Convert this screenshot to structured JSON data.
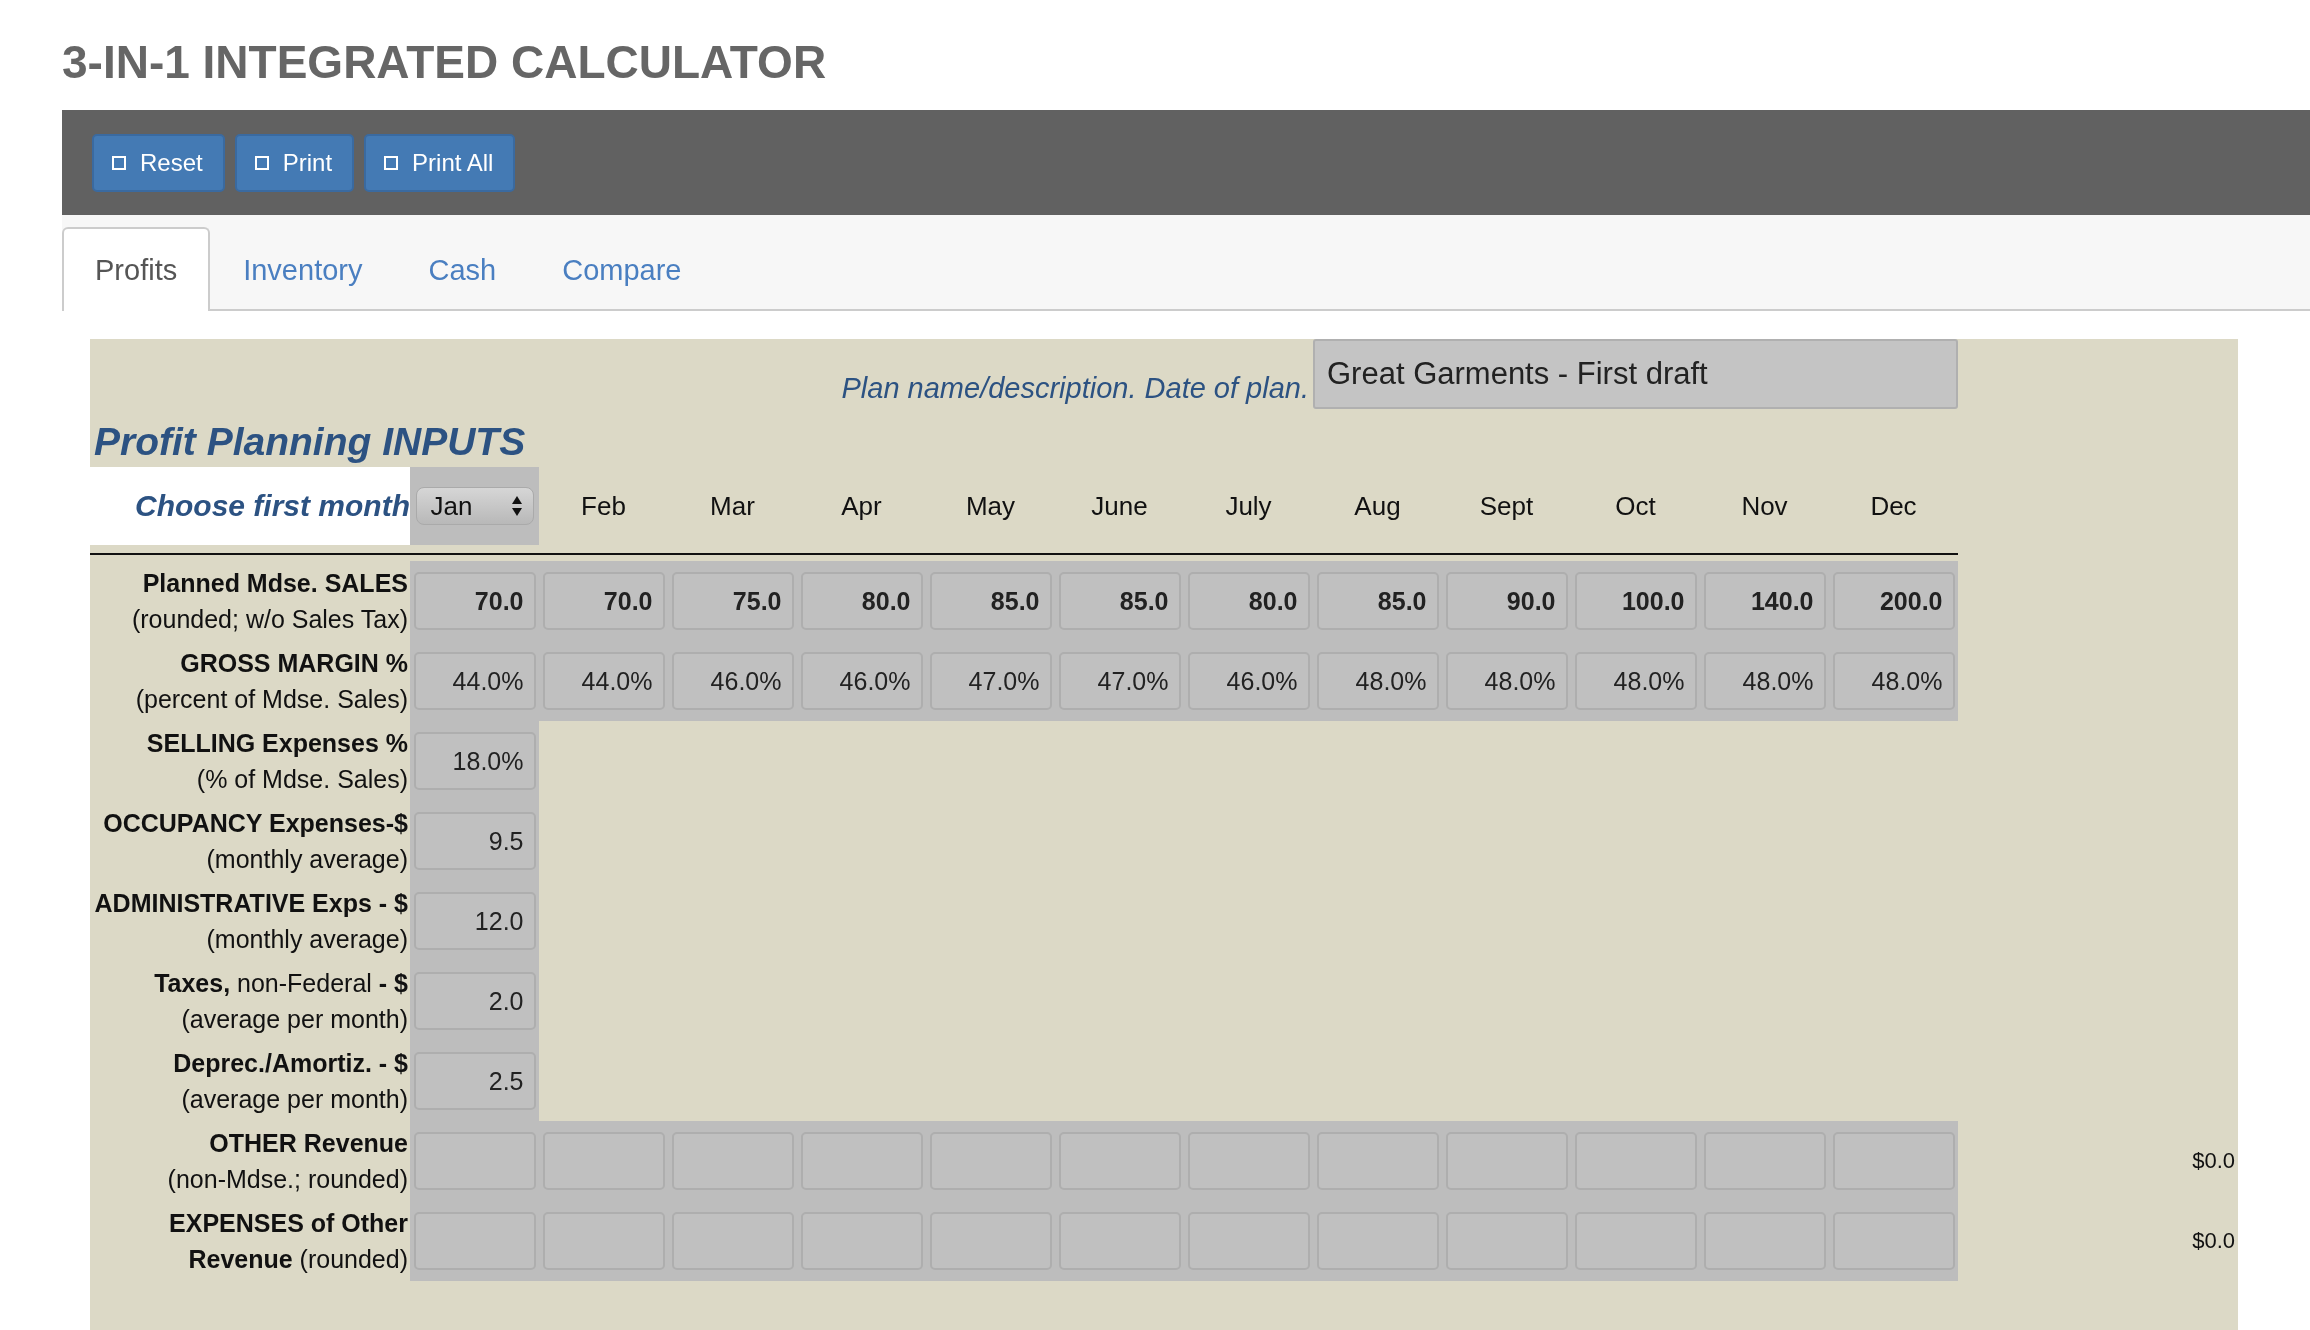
{
  "title": "3-IN-1 INTEGRATED CALCULATOR",
  "toolbar": {
    "buttons": [
      {
        "label": "Reset"
      },
      {
        "label": "Print"
      },
      {
        "label": "Print All"
      }
    ]
  },
  "tabs": [
    {
      "label": "Profits",
      "selected": true
    },
    {
      "label": "Inventory",
      "selected": false
    },
    {
      "label": "Cash",
      "selected": false
    },
    {
      "label": "Compare",
      "selected": false
    }
  ],
  "plan": {
    "label": "Plan name/description. Date of plan.",
    "value": "Great Garments - First draft"
  },
  "section_title": "Profit Planning INPUTS",
  "month_selector": {
    "label": "Choose first month",
    "value": "Jan"
  },
  "months": [
    "Feb",
    "Mar",
    "Apr",
    "May",
    "June",
    "July",
    "Aug",
    "Sept",
    "Oct",
    "Nov",
    "Dec"
  ],
  "rows": [
    {
      "kind": "monthly",
      "label": "Planned Mdse. SALES",
      "label_bold": true,
      "note": "(rounded; w/o Sales Tax)",
      "bold_values": true,
      "values": [
        "70.0",
        "70.0",
        "75.0",
        "80.0",
        "85.0",
        "85.0",
        "80.0",
        "85.0",
        "90.0",
        "100.0",
        "140.0",
        "200.0"
      ]
    },
    {
      "kind": "monthly",
      "label": "GROSS MARGIN %",
      "label_bold": true,
      "note": "(percent of Mdse. Sales)",
      "bold_values": false,
      "values": [
        "44.0%",
        "44.0%",
        "46.0%",
        "46.0%",
        "47.0%",
        "47.0%",
        "46.0%",
        "48.0%",
        "48.0%",
        "48.0%",
        "48.0%",
        "48.0%"
      ]
    },
    {
      "kind": "single",
      "label": "SELLING Expenses %",
      "label_bold": true,
      "note": "(% of Mdse. Sales)",
      "values": [
        "18.0%"
      ]
    },
    {
      "kind": "single",
      "label": "OCCUPANCY Expenses-$",
      "label_bold": true,
      "note": "(monthly average)",
      "values": [
        "9.5"
      ]
    },
    {
      "kind": "single",
      "label": "ADMINISTRATIVE Exps - $",
      "label_bold": true,
      "note": "(monthly average)",
      "values": [
        "12.0"
      ]
    },
    {
      "kind": "single",
      "label": "**Taxes,** non-Federal **- $**",
      "label_bold": false,
      "note": "(average per month)",
      "values": [
        "2.0"
      ]
    },
    {
      "kind": "single",
      "label": "Deprec./Amortiz. - $",
      "label_bold": true,
      "note": "(average per month)",
      "values": [
        "2.5"
      ]
    },
    {
      "kind": "blank",
      "label": "OTHER Revenue",
      "label_bold": true,
      "note": "(non-Mdse.; rounded)",
      "total": "$0.0"
    },
    {
      "kind": "blank",
      "label": "EXPENSES of Other",
      "label_bold": true,
      "note": "**Revenue** (rounded)",
      "total": "$0.0"
    }
  ]
}
